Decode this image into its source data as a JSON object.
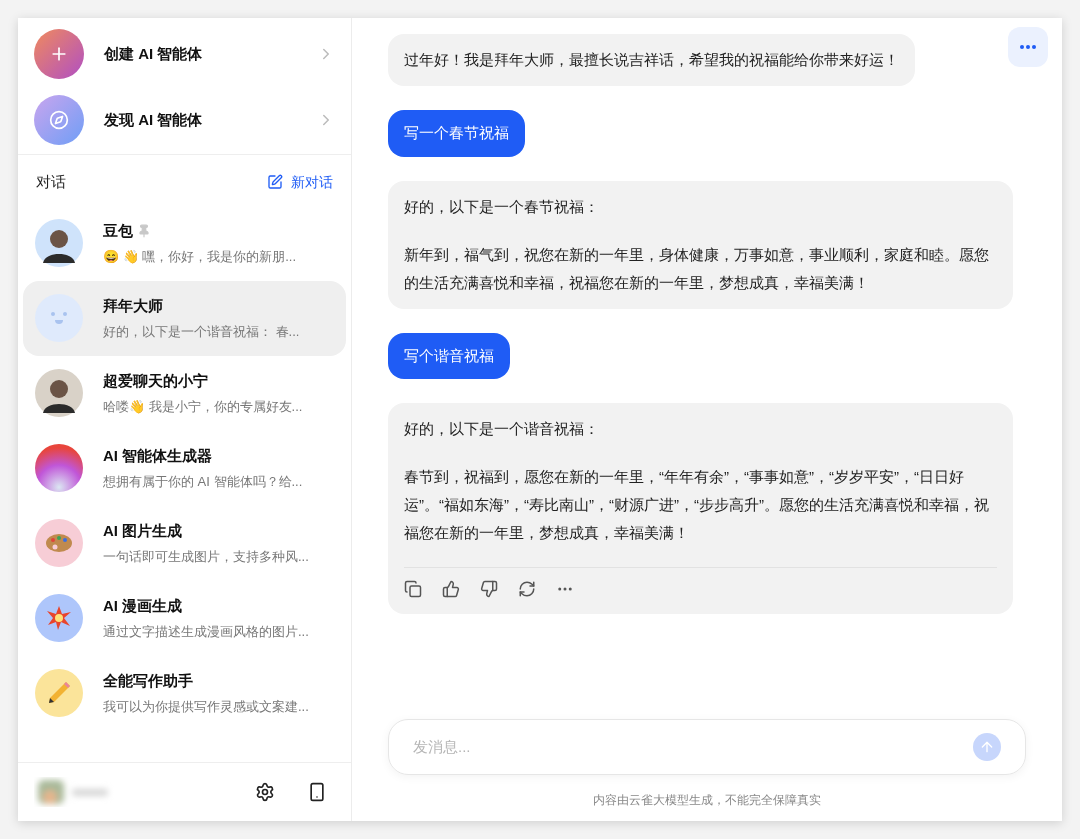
{
  "sidebar": {
    "actions": [
      {
        "kind": "create",
        "label": "创建 AI 智能体"
      },
      {
        "kind": "discover",
        "label": "发现 AI 智能体"
      }
    ],
    "section_title": "对话",
    "new_chat": "新对话",
    "conversations": [
      {
        "name": "豆包",
        "preview": "😄 👋 嘿，你好，我是你的新朋...",
        "pinned": true,
        "selected": false,
        "avatar": {
          "kind": "person",
          "color": "#cfe3fb"
        }
      },
      {
        "name": "拜年大师",
        "preview": "好的，以下是一个谐音祝福： 春...",
        "pinned": false,
        "selected": true,
        "avatar": {
          "kind": "bot",
          "color": "#dfeafc"
        }
      },
      {
        "name": "超爱聊天的小宁",
        "preview": "哈喽👋 我是小宁，你的专属好友...",
        "pinned": false,
        "selected": false,
        "avatar": {
          "kind": "person",
          "color": "#d9d2c8"
        }
      },
      {
        "name": "AI 智能体生成器",
        "preview": "想拥有属于你的 AI 智能体吗？给...",
        "pinned": false,
        "selected": false,
        "avatar": {
          "kind": "gradient"
        }
      },
      {
        "name": "AI 图片生成",
        "preview": "一句话即可生成图片，支持多种风...",
        "pinned": false,
        "selected": false,
        "avatar": {
          "kind": "palette",
          "color": "#f7cdd6"
        }
      },
      {
        "name": "AI 漫画生成",
        "preview": "通过文字描述生成漫画风格的图片...",
        "pinned": false,
        "selected": false,
        "avatar": {
          "kind": "burst",
          "color": "#aec6fb"
        }
      },
      {
        "name": "全能写作助手",
        "preview": "我可以为你提供写作灵感或文案建...",
        "pinned": false,
        "selected": false,
        "avatar": {
          "kind": "pencil",
          "color": "#fbe49a"
        }
      }
    ]
  },
  "chat": {
    "messages": [
      {
        "kind": "bot",
        "paragraphs": [
          "过年好！我是拜年大师，最擅长说吉祥话，希望我的祝福能给你带来好运！"
        ]
      },
      {
        "kind": "user",
        "paragraphs": [
          "写一个春节祝福"
        ]
      },
      {
        "kind": "bot",
        "paragraphs": [
          "好的，以下是一个春节祝福：",
          "新年到，福气到，祝您在新的一年里，身体健康，万事如意，事业顺利，家庭和睦。愿您的生活充满喜悦和幸福，祝福您在新的一年里，梦想成真，幸福美满！"
        ]
      },
      {
        "kind": "user",
        "paragraphs": [
          "写个谐音祝福"
        ]
      },
      {
        "kind": "bot",
        "paragraphs": [
          "好的，以下是一个谐音祝福：",
          "春节到，祝福到，愿您在新的一年里，“年年有余”，“事事如意”，“岁岁平安”，“日日好运”。“福如东海”，“寿比南山”，“财源广进”，“步步高升”。愿您的生活充满喜悦和幸福，祝福您在新的一年里，梦想成真，幸福美满！"
        ],
        "actions": true
      }
    ],
    "input": {
      "placeholder": "发消息..."
    },
    "disclaimer": "内容由云雀大模型生成，不能完全保障真实"
  }
}
